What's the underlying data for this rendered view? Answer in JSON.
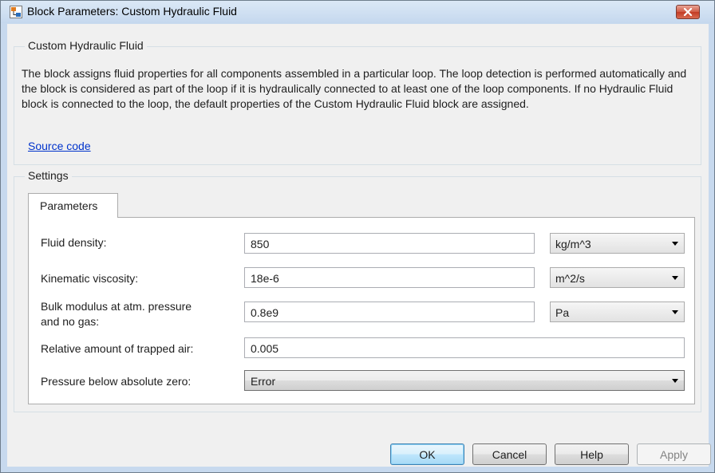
{
  "window": {
    "title": "Block Parameters: Custom Hydraulic Fluid",
    "close_glyph": "✕"
  },
  "block": {
    "group_title": "Custom Hydraulic Fluid",
    "description": "The block assigns fluid properties for all components assembled in a particular loop. The loop detection is performed automatically and the block is considered as part of the loop if it is hydraulically connected to at least one of the loop components. If no Hydraulic Fluid block is connected to the loop, the default properties of the Custom Hydraulic Fluid block are assigned.",
    "source_link": "Source code"
  },
  "settings": {
    "group_title": "Settings",
    "tab_label": "Parameters"
  },
  "params": {
    "density": {
      "label": "Fluid density:",
      "value": "850",
      "unit": "kg/m^3"
    },
    "viscosity": {
      "label": "Kinematic viscosity:",
      "value": "18e-6",
      "unit": "m^2/s"
    },
    "bulk": {
      "label_line1": "Bulk modulus at atm. pressure",
      "label_line2": "and no gas:",
      "value": "0.8e9",
      "unit": "Pa"
    },
    "trapped_air": {
      "label": "Relative amount of trapped air:",
      "value": "0.005"
    },
    "pressure_below_zero": {
      "label": "Pressure below absolute zero:",
      "value": "Error"
    }
  },
  "buttons": {
    "ok": "OK",
    "cancel": "Cancel",
    "help": "Help",
    "apply": "Apply"
  },
  "icons": {
    "app": "simulink-block-icon",
    "close": "close-icon",
    "dropdown": "chevron-down-icon"
  },
  "colors": {
    "titlebar": "#c5d8ee",
    "client": "#f0f0f0",
    "link": "#0033cc",
    "close_button": "#c23b25",
    "ok_button": "#bee6fd"
  }
}
